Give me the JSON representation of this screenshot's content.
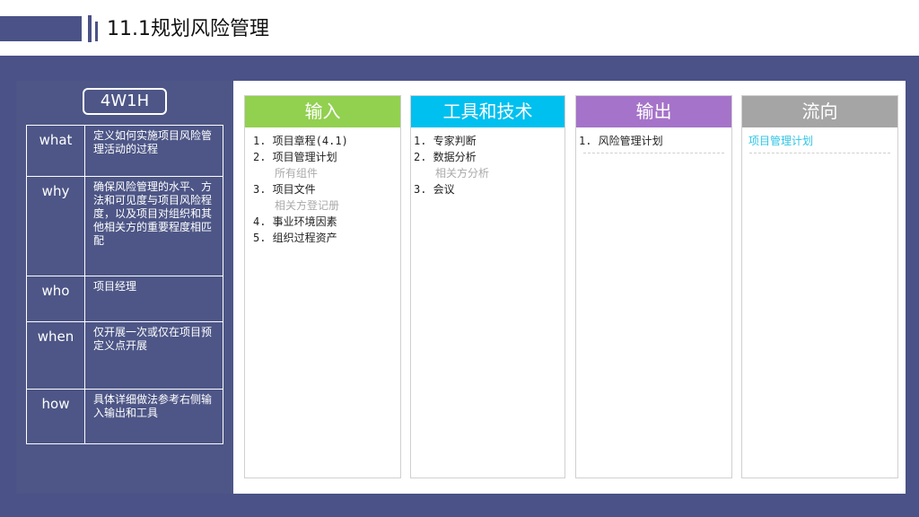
{
  "header": {
    "title": "11.1规划风险管理"
  },
  "left": {
    "badge": "4W1H",
    "rows": [
      {
        "key": "what",
        "value": "定义如何实施项目风险管理活动的过程"
      },
      {
        "key": "why",
        "value": "确保风险管理的水平、方法和可见度与项目风险程度，以及项目对组织和其他相关方的重要程度相匹配"
      },
      {
        "key": "who",
        "value": "项目经理"
      },
      {
        "key": "when",
        "value": "仅开展一次或仅在项目预定义点开展"
      },
      {
        "key": "how",
        "value": "具体详细做法参考右侧输入输出和工具"
      }
    ]
  },
  "columns": {
    "input": {
      "title": "输入",
      "color": "#92d050",
      "items": [
        "1. 项目章程(4.1)",
        "2. 项目管理计划",
        "所有组件",
        "3. 项目文件",
        "相关方登记册",
        "4. 事业环境因素",
        "5. 组织过程资产"
      ]
    },
    "tools": {
      "title": "工具和技术",
      "color": "#00c0ef",
      "items": [
        "1. 专家判断",
        "2. 数据分析",
        "相关方分析",
        "3. 会议"
      ]
    },
    "output": {
      "title": "输出",
      "color": "#a573c9",
      "items": [
        "1. 风险管理计划"
      ]
    },
    "flow": {
      "title": "流向",
      "color": "#a5a5a5",
      "items": [
        "项目管理计划"
      ]
    }
  }
}
